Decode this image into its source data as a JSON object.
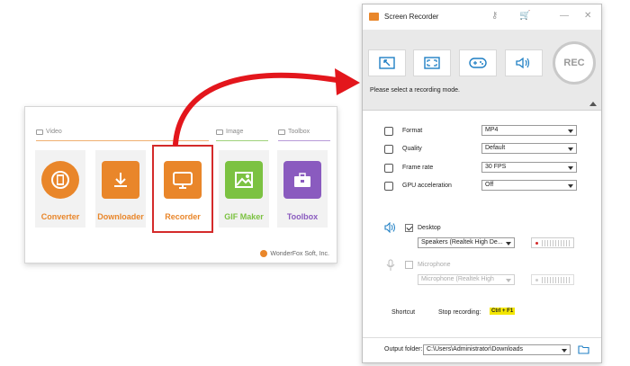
{
  "launcher": {
    "categories": {
      "video": "Video",
      "image": "Image",
      "toolbox": "Toolbox"
    },
    "tiles": [
      {
        "label": "Converter",
        "color": "#e9862a",
        "icon": "film-reel-icon"
      },
      {
        "label": "Downloader",
        "color": "#e9862a",
        "icon": "download-arrow-icon"
      },
      {
        "label": "Recorder",
        "color": "#e9862a",
        "icon": "screen-recorder-icon"
      },
      {
        "label": "GIF Maker",
        "color": "#7cc242",
        "icon": "image-landscape-icon"
      },
      {
        "label": "Toolbox",
        "color": "#8a5bbf",
        "icon": "toolbox-briefcase-icon"
      }
    ],
    "brand": "WonderFox Soft, Inc."
  },
  "recorder": {
    "title": "Screen Recorder",
    "hint": "Please select a recording mode.",
    "rec_label": "REC",
    "modes": [
      "region-select-icon",
      "fullscreen-icon",
      "gamepad-icon",
      "speaker-audio-icon"
    ],
    "settings": {
      "format": {
        "label": "Format",
        "value": "MP4"
      },
      "quality": {
        "label": "Quality",
        "value": "Default"
      },
      "frame_rate": {
        "label": "Frame rate",
        "value": "30 FPS"
      },
      "gpu": {
        "label": "GPU acceleration",
        "value": "Off"
      }
    },
    "audio": {
      "desktop": {
        "label": "Desktop",
        "device": "Speakers (Realtek High De...",
        "checked": true
      },
      "microphone": {
        "label": "Microphone",
        "device": "Microphone (Realtek High",
        "checked": false
      }
    },
    "shortcut": {
      "label": "Shortcut",
      "stop_label": "Stop recording:",
      "key": "Ctrl + F1"
    },
    "output": {
      "label": "Output folder:",
      "path": "C:\\Users\\Administrator\\Downloads"
    }
  },
  "colors": {
    "accent": "#e9862a",
    "highlight": "#d42a2a",
    "arrow": "#e3161c"
  }
}
